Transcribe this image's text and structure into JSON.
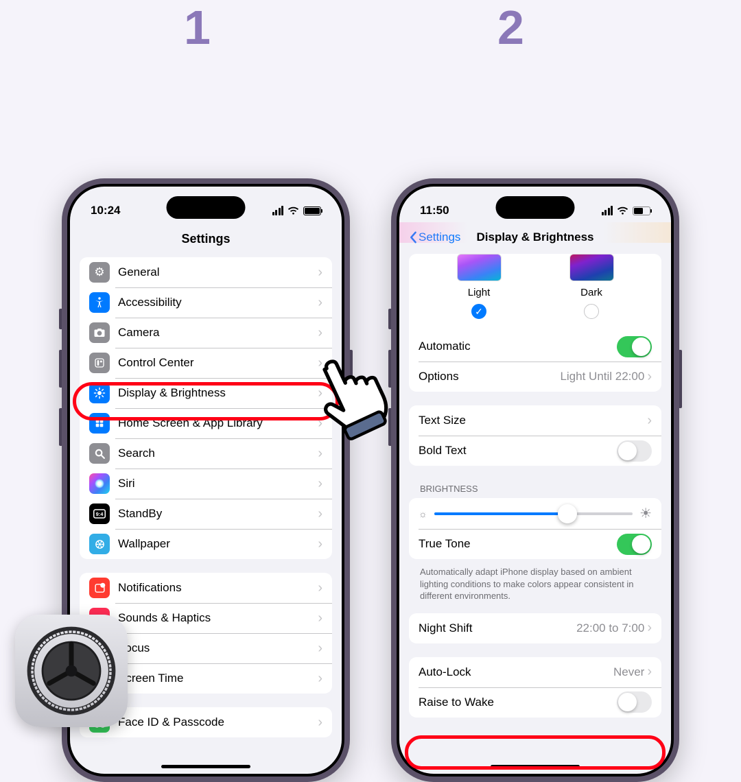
{
  "steps": {
    "one": "1",
    "two": "2"
  },
  "phone1": {
    "time": "10:24",
    "title": "Settings",
    "group1": [
      {
        "label": "General",
        "icon_name": "general-icon"
      },
      {
        "label": "Accessibility",
        "icon_name": "accessibility-icon"
      },
      {
        "label": "Camera",
        "icon_name": "camera-icon"
      },
      {
        "label": "Control Center",
        "icon_name": "control-center-icon"
      },
      {
        "label": "Display & Brightness",
        "icon_name": "display-brightness-icon"
      },
      {
        "label": "Home Screen & App Library",
        "icon_name": "home-screen-icon"
      },
      {
        "label": "Search",
        "icon_name": "search-icon"
      },
      {
        "label": "Siri",
        "icon_name": "siri-icon"
      },
      {
        "label": "StandBy",
        "icon_name": "standby-icon"
      },
      {
        "label": "Wallpaper",
        "icon_name": "wallpaper-icon"
      }
    ],
    "group2": [
      {
        "label": "Notifications",
        "icon_name": "notifications-icon"
      },
      {
        "label": "Sounds & Haptics",
        "icon_name": "sound-icon"
      },
      {
        "label": "Focus",
        "icon_name": "focus-icon"
      },
      {
        "label": "Screen Time",
        "icon_name": "screen-time-icon"
      }
    ],
    "group3_first": {
      "label": "Face ID & Passcode",
      "icon_name": "faceid-icon"
    }
  },
  "phone2": {
    "time": "11:50",
    "back_label": "Settings",
    "title": "Display & Brightness",
    "appearance": {
      "light_label": "Light",
      "dark_label": "Dark",
      "selected": "light"
    },
    "automatic": {
      "label": "Automatic",
      "on": true
    },
    "options": {
      "label": "Options",
      "value": "Light Until 22:00"
    },
    "text_size": {
      "label": "Text Size"
    },
    "bold_text": {
      "label": "Bold Text",
      "on": false
    },
    "brightness_header": "BRIGHTNESS",
    "brightness_value_pct": 67,
    "true_tone": {
      "label": "True Tone",
      "on": true
    },
    "true_tone_footer": "Automatically adapt iPhone display based on ambient lighting conditions to make colors appear consistent in different environments.",
    "night_shift": {
      "label": "Night Shift",
      "value": "22:00 to 7:00"
    },
    "auto_lock": {
      "label": "Auto-Lock",
      "value": "Never"
    },
    "raise_to_wake": {
      "label": "Raise to Wake",
      "on": false
    }
  }
}
